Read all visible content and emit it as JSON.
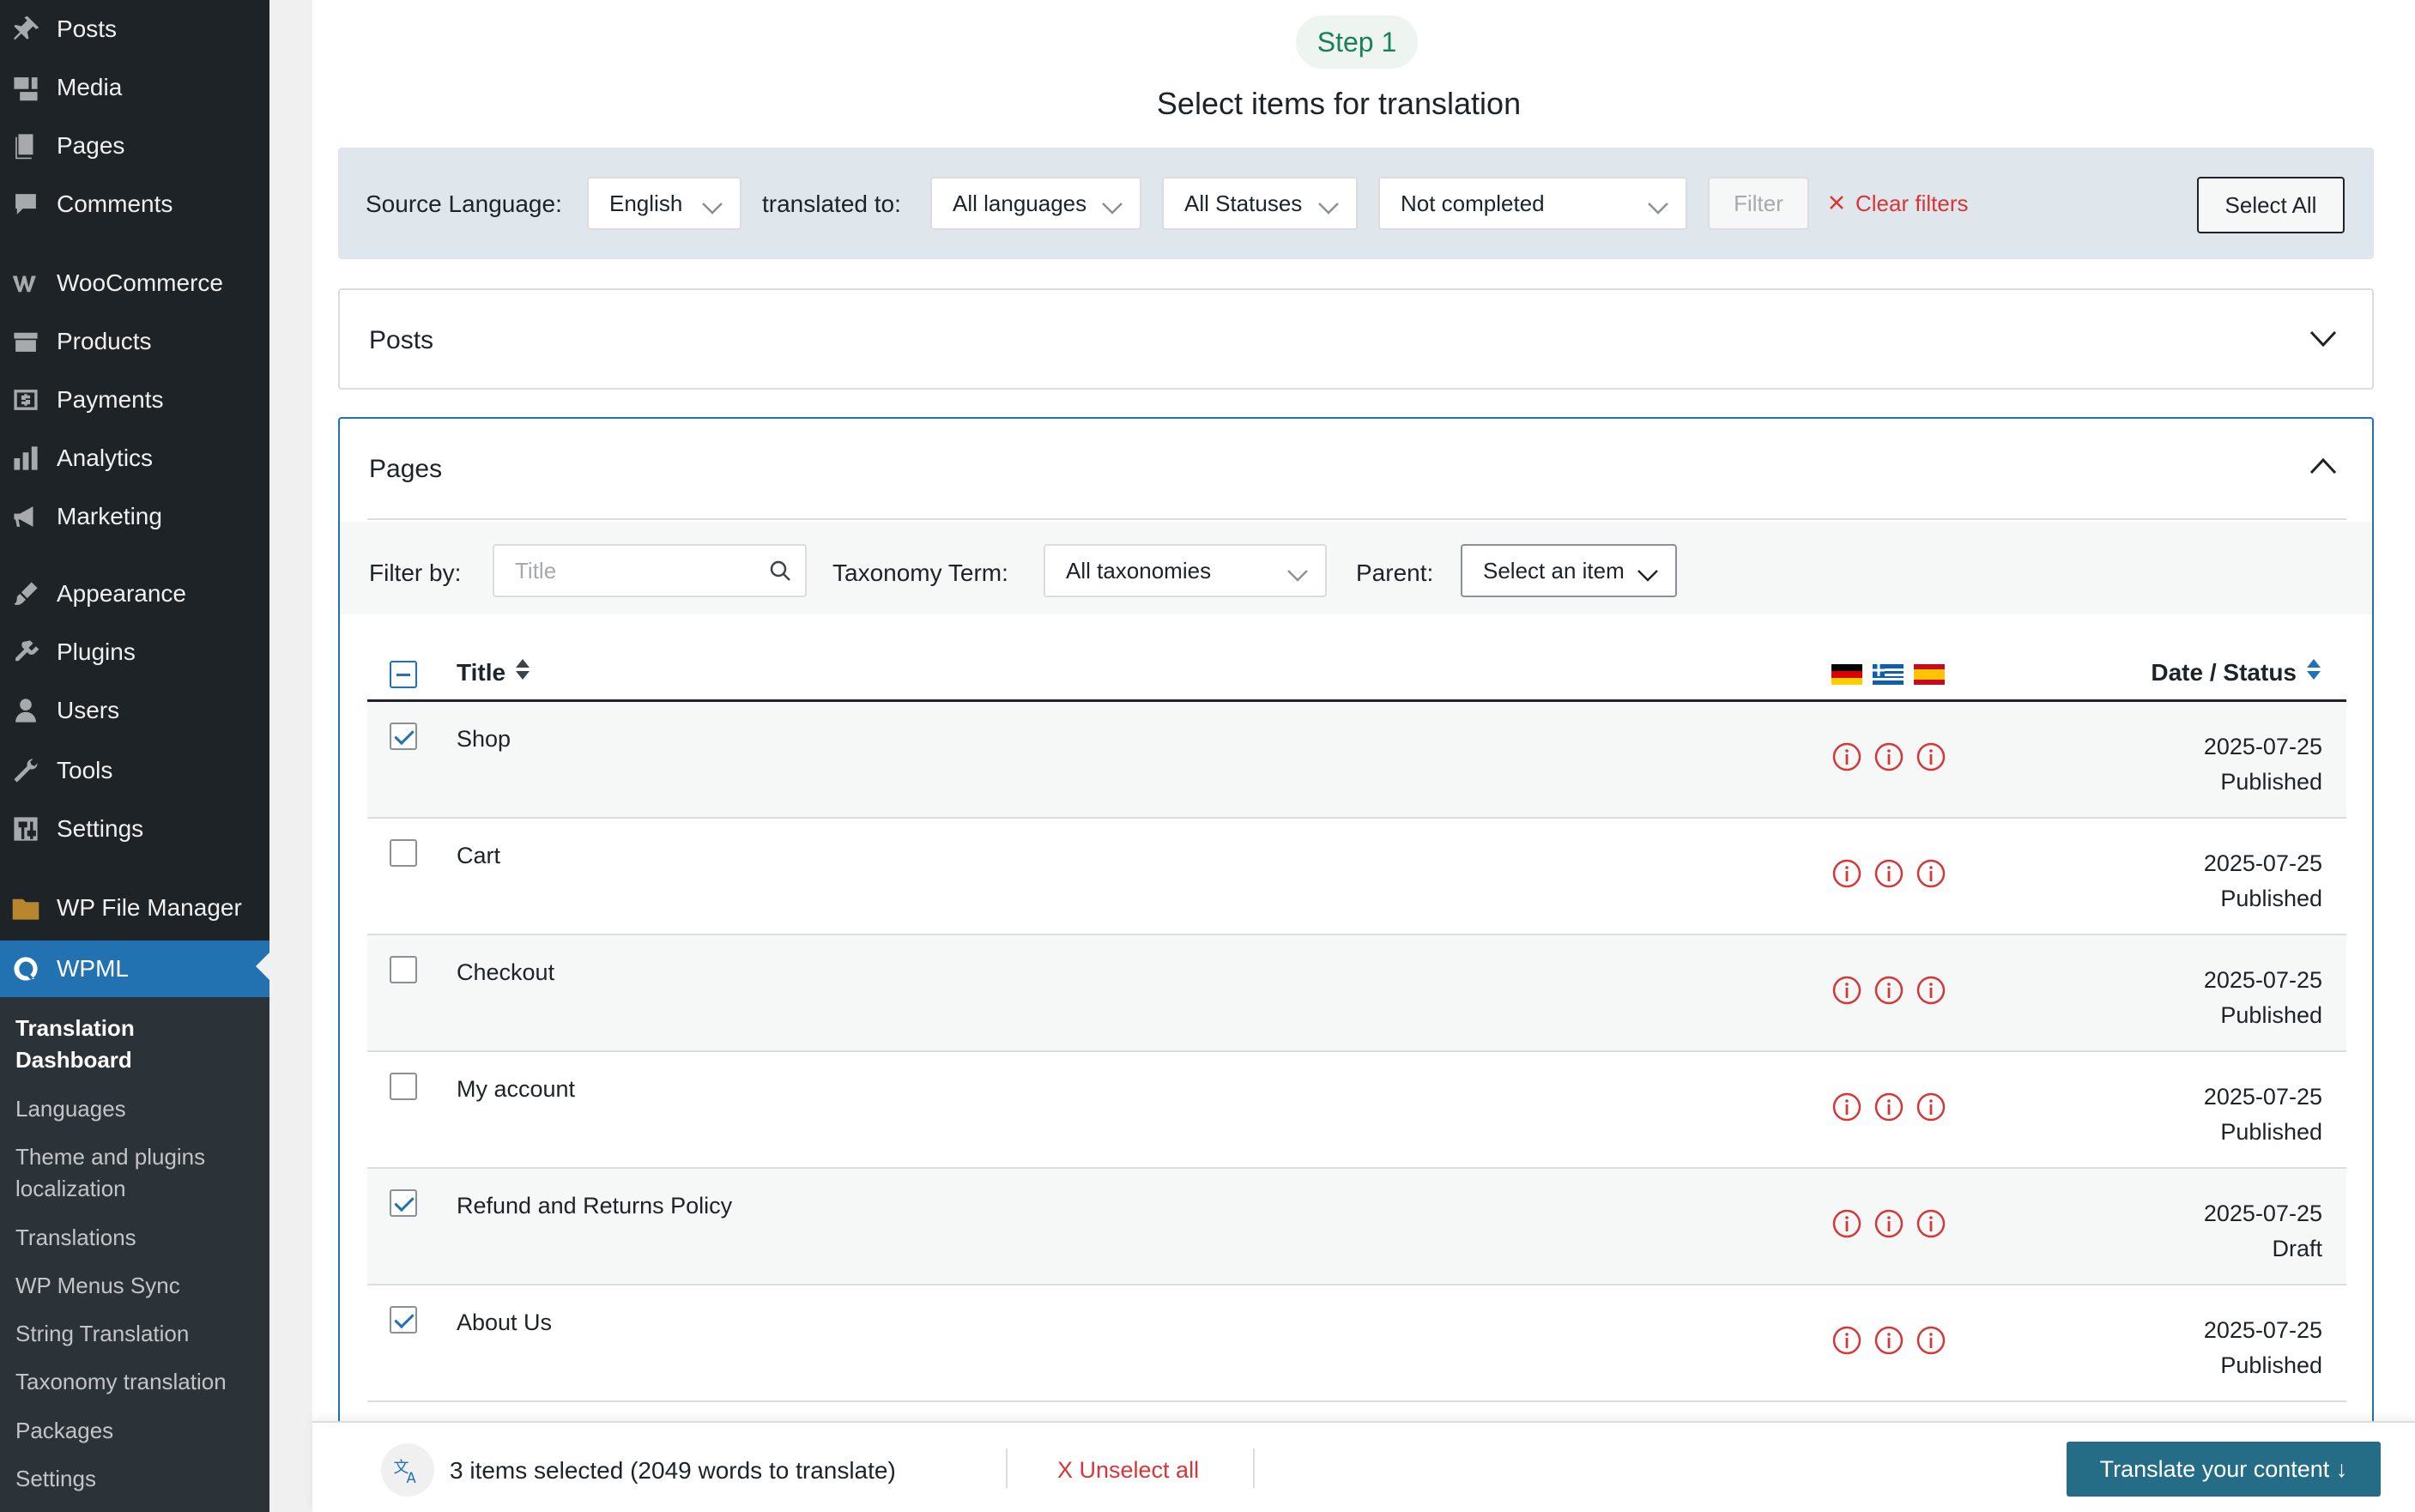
{
  "sidebar": {
    "items": [
      {
        "label": "Posts",
        "icon": "pin-icon"
      },
      {
        "label": "Media",
        "icon": "media-icon"
      },
      {
        "label": "Pages",
        "icon": "pages-icon"
      },
      {
        "label": "Comments",
        "icon": "comments-icon"
      },
      {
        "label": "WooCommerce",
        "icon": "woocommerce-icon"
      },
      {
        "label": "Products",
        "icon": "products-icon"
      },
      {
        "label": "Payments",
        "icon": "payments-icon"
      },
      {
        "label": "Analytics",
        "icon": "analytics-icon"
      },
      {
        "label": "Marketing",
        "icon": "marketing-icon"
      },
      {
        "label": "Appearance",
        "icon": "appearance-icon"
      },
      {
        "label": "Plugins",
        "icon": "plugins-icon"
      },
      {
        "label": "Users",
        "icon": "users-icon"
      },
      {
        "label": "Tools",
        "icon": "tools-icon"
      },
      {
        "label": "Settings",
        "icon": "settings-icon"
      },
      {
        "label": "WP File Manager",
        "icon": "file-manager-icon"
      },
      {
        "label": "WPML",
        "icon": "wpml-icon"
      }
    ],
    "submenu": [
      "Translation Dashboard",
      "Languages",
      "Theme and plugins localization",
      "Translations",
      "WP Menus Sync",
      "String Translation",
      "Taxonomy translation",
      "Packages",
      "Settings"
    ]
  },
  "header": {
    "step": "Step 1",
    "title": "Select items for translation"
  },
  "filters": {
    "source_label": "Source Language:",
    "source_value": "English",
    "translated_label": "translated to:",
    "translated_value": "All languages",
    "status_value": "All Statuses",
    "completion_value": "Not completed",
    "filter_button": "Filter",
    "clear_filters": "Clear filters",
    "select_all": "Select All"
  },
  "sections": {
    "posts_title": "Posts",
    "pages_title": "Pages"
  },
  "pages_filter": {
    "filter_by": "Filter by:",
    "title_placeholder": "Title",
    "taxonomy_label": "Taxonomy Term:",
    "taxonomy_value": "All taxonomies",
    "parent_label": "Parent:",
    "parent_value": "Select an item"
  },
  "table": {
    "col_title": "Title",
    "col_date": "Date / Status",
    "flags": [
      "de",
      "gr",
      "es"
    ],
    "rows": [
      {
        "title": "Shop",
        "date": "2025-07-25",
        "status": "Published",
        "checked": true
      },
      {
        "title": "Cart",
        "date": "2025-07-25",
        "status": "Published",
        "checked": false
      },
      {
        "title": "Checkout",
        "date": "2025-07-25",
        "status": "Published",
        "checked": false
      },
      {
        "title": "My account",
        "date": "2025-07-25",
        "status": "Published",
        "checked": false
      },
      {
        "title": "Refund and Returns Policy",
        "date": "2025-07-25",
        "status": "Draft",
        "checked": true
      },
      {
        "title": "About Us",
        "date": "2025-07-25",
        "status": "Published",
        "checked": true
      }
    ]
  },
  "bottom_bar": {
    "selected_text": "3 items selected (2049 words to translate)",
    "unselect_all": "X Unselect all",
    "translate_button": "Translate your content ↓"
  },
  "colors": {
    "sidebar_bg": "#1d2327",
    "active_blue": "#2271b1",
    "status_icon_red": "#d63638",
    "translate_button": "#256c86",
    "step_green": "#1a7f5a"
  }
}
